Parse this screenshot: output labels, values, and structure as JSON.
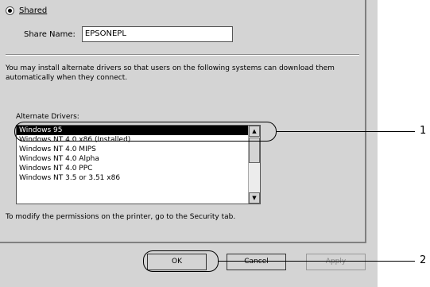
{
  "sharing": {
    "shared_label": "Shared",
    "share_name_label": "Share Name:",
    "share_name_value": "EPSONEPL"
  },
  "info_text": "You may install alternate drivers so that users on the following systems can download them automatically when they connect.",
  "alternate_drivers": {
    "label": "Alternate Drivers:",
    "items": [
      {
        "label": "Windows 95",
        "selected": true
      },
      {
        "label": "Windows NT 4.0 x86 (Installed)",
        "selected": false
      },
      {
        "label": "Windows NT 4.0 MIPS",
        "selected": false
      },
      {
        "label": "Windows NT 4.0 Alpha",
        "selected": false
      },
      {
        "label": "Windows NT 4.0 PPC",
        "selected": false
      },
      {
        "label": "Windows NT 3.5 or 3.51 x86",
        "selected": false
      }
    ]
  },
  "permissions_text": "To modify the permissions on the printer, go to the Security tab.",
  "buttons": {
    "ok": "OK",
    "cancel": "Cancel",
    "apply": "Apply"
  },
  "callouts": {
    "one": "1",
    "two": "2"
  }
}
